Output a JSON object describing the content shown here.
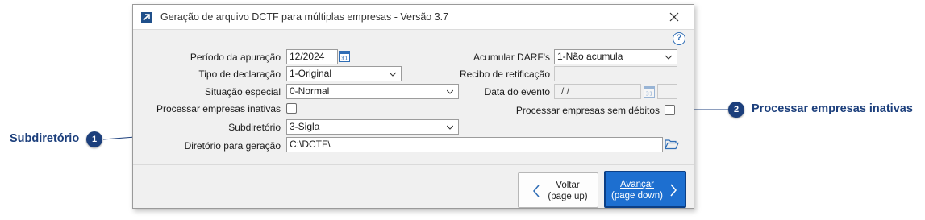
{
  "window": {
    "title": "Geração de arquivo DCTF para múltiplas empresas - Versão 3.7",
    "help_label": "?"
  },
  "form": {
    "periodo_label": "Período da apuração",
    "periodo_value": "12/2024",
    "tipo_label": "Tipo de declaração",
    "tipo_value": "1-Original",
    "situacao_label": "Situação especial",
    "situacao_value": "0-Normal",
    "processar_inativas_label": "Processar empresas inativas",
    "subdiretorio_label": "Subdiretório",
    "subdiretorio_value": "3-Sigla",
    "diretorio_label": "Diretório para geração",
    "diretorio_value": "C:\\DCTF\\",
    "acumular_label": "Acumular DARF's",
    "acumular_value": "1-Não acumula",
    "recibo_label": "Recibo de retificação",
    "recibo_value": "",
    "data_evento_label": "Data do evento",
    "data_evento_value": "/ /",
    "processar_sem_debitos_label": "Processar empresas sem débitos"
  },
  "buttons": {
    "back_line1": "Voltar",
    "back_line2": "(page up)",
    "next_line1": "Avançar",
    "next_line2": "(page down)"
  },
  "callouts": [
    {
      "number": "1",
      "text": "Subdiretório"
    },
    {
      "number": "2",
      "text": "Processar empresas inativas"
    }
  ],
  "colors": {
    "accent": "#1d6fd0",
    "callout": "#1c3f7c",
    "window_bg": "#f0f0f0"
  }
}
